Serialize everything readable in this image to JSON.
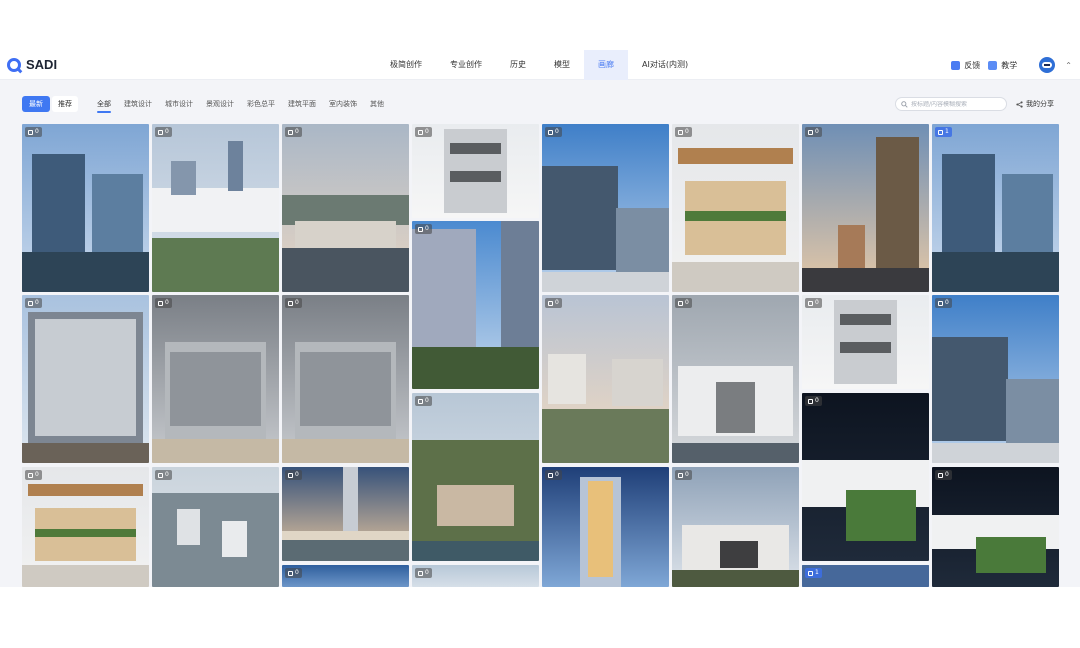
{
  "app": {
    "name": "SADI"
  },
  "nav": {
    "items": [
      "极简创作",
      "专业创作",
      "历史",
      "模型",
      "画廊",
      "AI对话(内测)"
    ],
    "active_index": 4
  },
  "header_right": {
    "feedback": "反馈",
    "tutorial": "教学"
  },
  "filters": {
    "sort": {
      "latest": "最新",
      "recommend": "推荐"
    },
    "categories": [
      "全部",
      "建筑设计",
      "城市设计",
      "景观设计",
      "彩色总平",
      "建筑平面",
      "室内装饰",
      "其他"
    ],
    "active_category_index": 0,
    "search_placeholder": "按标题/内容模糊搜索",
    "my_share": "我的分享"
  },
  "colors": {
    "accent": "#3f78f2",
    "nav_active_bg": "#e9eefc"
  },
  "gallery": {
    "tiles": [
      {
        "likes": "0",
        "scene": "glass-towers-waterfront"
      },
      {
        "likes": "0",
        "scene": "white-curved-complex"
      },
      {
        "likes": "0",
        "scene": "mountain-lake-town"
      },
      {
        "likes": "0",
        "scene": "stacked-white-balconies"
      },
      {
        "likes": "0",
        "scene": "glass-building-cloud"
      },
      {
        "likes": "0",
        "scene": "wood-roof-pavilion"
      },
      {
        "likes": "0",
        "scene": "tower-sunset-pyramid"
      },
      {
        "likes": "1",
        "scene": "glass-towers-waterfront"
      },
      {
        "likes": "0",
        "scene": "grid-facade-corner"
      },
      {
        "likes": "0",
        "scene": "glass-cube-cloudy"
      },
      {
        "likes": "0",
        "scene": "glass-cube-cloudy"
      },
      {
        "likes": "0",
        "scene": "glass-tower-blue-sky"
      },
      {
        "likes": "0",
        "scene": "campus-aerial-sunset"
      },
      {
        "likes": "0",
        "scene": "white-box-building"
      },
      {
        "likes": "0",
        "scene": "stacked-white-balconies"
      },
      {
        "likes": "0",
        "scene": "glass-building-cloud"
      },
      {
        "likes": "0",
        "scene": "wood-roof-pavilion"
      },
      {
        "likes": "0",
        "scene": "city-aerial-dense"
      },
      {
        "likes": "0",
        "scene": "twisted-tower-river"
      },
      {
        "likes": "0",
        "scene": "riverside-village-aerial"
      },
      {
        "likes": "0",
        "scene": "twisted-glass-tower"
      },
      {
        "likes": "0",
        "scene": "modern-house-dusk"
      },
      {
        "likes": "0",
        "scene": "white-curve-night"
      },
      {
        "likes": "0",
        "scene": "white-curve-night"
      },
      {
        "likes": "0",
        "scene": "blue-sky-partial"
      },
      {
        "likes": "0",
        "scene": "clear-sky-partial"
      },
      {
        "likes": "1",
        "scene": "glass-edge-partial"
      }
    ]
  }
}
